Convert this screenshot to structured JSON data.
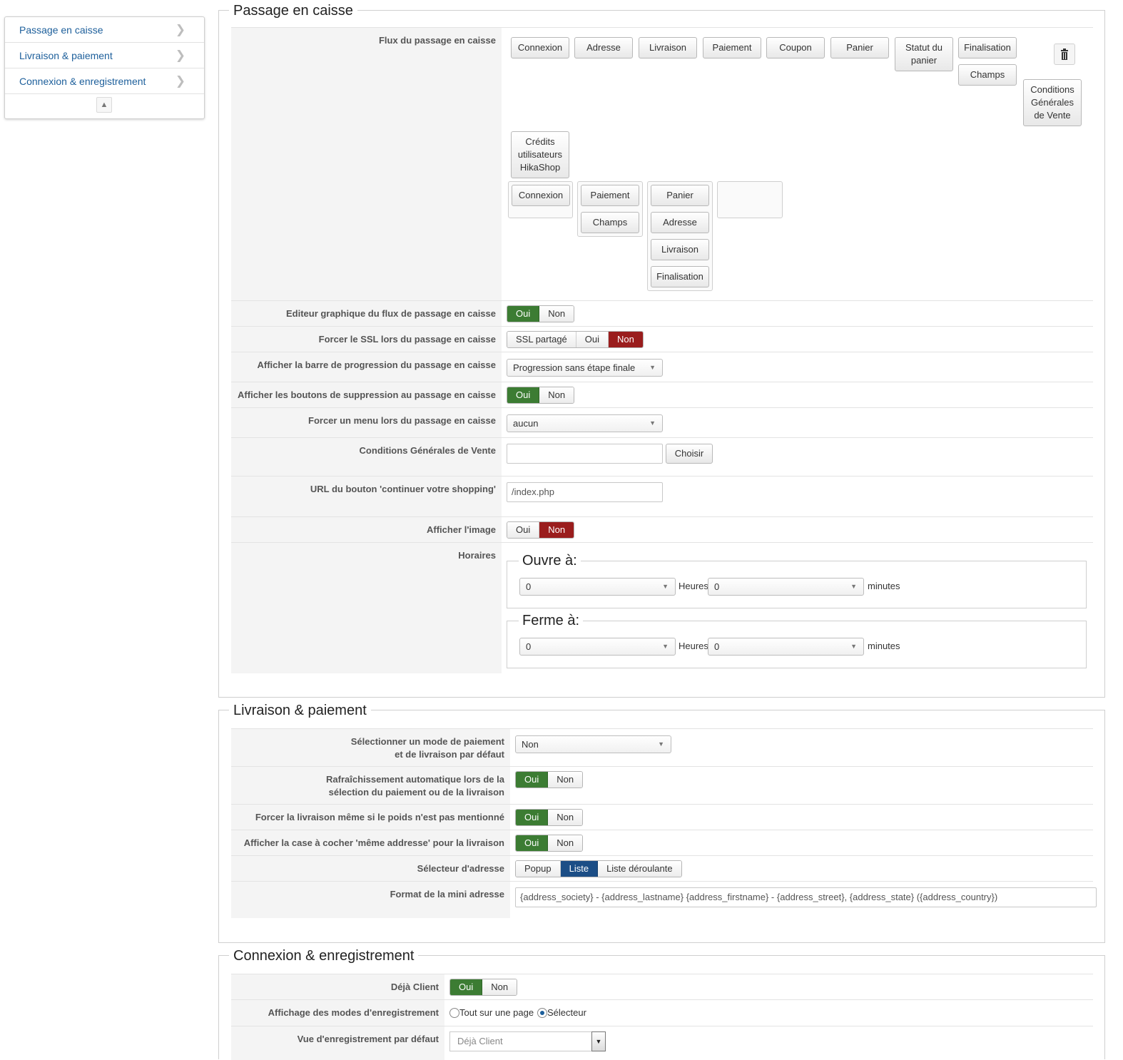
{
  "sidebar": {
    "items": [
      {
        "label": "Passage en caisse"
      },
      {
        "label": "Livraison & paiement"
      },
      {
        "label": "Connexion & enregistrement"
      }
    ]
  },
  "checkout": {
    "legend": "Passage en caisse",
    "flow_label": "Flux du passage en caisse",
    "flow_buttons": {
      "connexion": "Connexion",
      "adresse": "Adresse",
      "livraison": "Livraison",
      "paiement": "Paiement",
      "coupon": "Coupon",
      "panier": "Panier",
      "statut_panier": "Statut du panier",
      "finalisation": "Finalisation",
      "champs": "Champs",
      "cgv": "Conditions Générales de Vente",
      "credits": "Crédits utilisateurs HikaShop"
    },
    "steps": {
      "s1": [
        "Connexion"
      ],
      "s2": [
        "Paiement",
        "Champs"
      ],
      "s3": [
        "Panier",
        "Adresse",
        "Livraison",
        "Finalisation"
      ]
    },
    "graphic_editor": {
      "label": "Editeur graphique du flux de passage en caisse",
      "yes": "Oui",
      "no": "Non"
    },
    "force_ssl": {
      "label": "Forcer le SSL lors du passage en caisse",
      "shared": "SSL partagé",
      "yes": "Oui",
      "no": "Non"
    },
    "progress_bar": {
      "label": "Afficher la barre de progression du passage en caisse",
      "value": "Progression sans étape finale"
    },
    "delete_buttons": {
      "label": "Afficher les boutons de suppression au passage en caisse",
      "yes": "Oui",
      "no": "Non"
    },
    "force_menu": {
      "label": "Forcer un menu lors du passage en caisse",
      "value": "aucun"
    },
    "terms": {
      "label": "Conditions Générales de Vente",
      "value": "",
      "button": "Choisir"
    },
    "continue_url": {
      "label": "URL du bouton 'continuer votre shopping'",
      "value": "/index.php"
    },
    "show_image": {
      "label": "Afficher l'image",
      "yes": "Oui",
      "no": "Non"
    },
    "hours": {
      "label": "Horaires",
      "open_legend": "Ouvre à:",
      "close_legend": "Ferme à:",
      "open_hours": "0",
      "open_minutes": "0",
      "close_hours": "0",
      "close_minutes": "0",
      "hours_unit": "Heures",
      "minutes_unit": "minutes"
    }
  },
  "shipping": {
    "legend": "Livraison & paiement",
    "default_mode": {
      "label_line1": "Sélectionner un mode de paiement",
      "label_line2": "et de livraison par défaut",
      "value": "Non"
    },
    "auto_refresh": {
      "label_line1": "Rafraîchissement automatique lors de la",
      "label_line2": "sélection du paiement ou de la livraison",
      "yes": "Oui",
      "no": "Non"
    },
    "force_shipping": {
      "label": "Forcer la livraison même si le poids n'est pas mentionné",
      "yes": "Oui",
      "no": "Non"
    },
    "same_address": {
      "label": "Afficher la case à cocher 'même addresse' pour la livraison",
      "yes": "Oui",
      "no": "Non"
    },
    "address_selector": {
      "label": "Sélecteur d'adresse",
      "popup": "Popup",
      "list": "Liste",
      "dropdown": "Liste déroulante"
    },
    "mini_address": {
      "label": "Format de la mini adresse",
      "value": "{address_society} - {address_lastname} {address_firstname} - {address_street}, {address_state} ({address_country})"
    }
  },
  "login": {
    "legend": "Connexion & enregistrement",
    "already_client": {
      "label": "Déjà Client",
      "yes": "Oui",
      "no": "Non"
    },
    "registration_modes": {
      "label": "Affichage des modes d'enregistrement",
      "opt1": "Tout sur une page",
      "opt2": "Sélecteur"
    },
    "default_view": {
      "label": "Vue d'enregistrement par défaut",
      "value": "Déjà Client"
    }
  },
  "colors": {
    "green": "#3c7c33",
    "red": "#9a1d1d",
    "blue": "#1c4e86",
    "link": "#1d5f9b"
  }
}
